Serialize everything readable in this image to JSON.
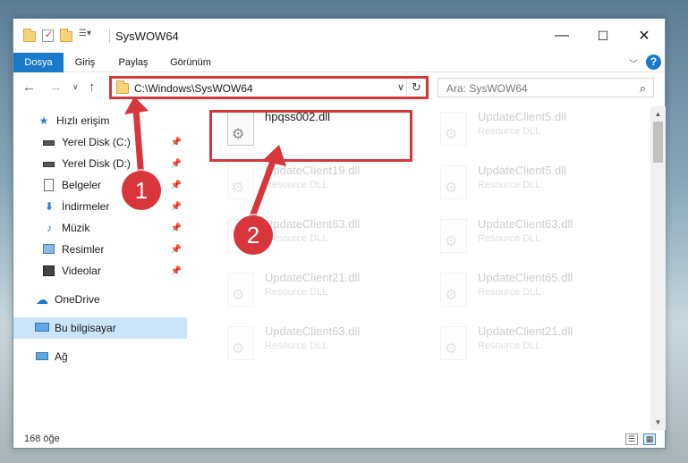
{
  "window": {
    "title": "SysWOW64",
    "controls": {
      "minimize": "—",
      "maximize": "☐",
      "close": "✕"
    }
  },
  "ribbon": {
    "tabs": [
      {
        "label": "Dosya",
        "active": true
      },
      {
        "label": "Giriş",
        "active": false
      },
      {
        "label": "Paylaş",
        "active": false
      },
      {
        "label": "Görünüm",
        "active": false
      }
    ],
    "help_label": "?"
  },
  "navigation": {
    "address": "C:\\Windows\\SysWOW64",
    "search_placeholder": "Ara: SysWOW64"
  },
  "sidebar": {
    "items": [
      {
        "label": "Hızlı erişim",
        "icon": "star-icon",
        "pinned": false,
        "selected": false
      },
      {
        "label": "Yerel Disk (C:)",
        "icon": "drive-icon",
        "pinned": true,
        "selected": false
      },
      {
        "label": "Yerel Disk (D:)",
        "icon": "drive-icon",
        "pinned": true,
        "selected": false
      },
      {
        "label": "Belgeler",
        "icon": "documents-icon",
        "pinned": true,
        "selected": false
      },
      {
        "label": "İndirmeler",
        "icon": "download-icon",
        "pinned": true,
        "selected": false
      },
      {
        "label": "Müzik",
        "icon": "music-icon",
        "pinned": true,
        "selected": false
      },
      {
        "label": "Resimler",
        "icon": "pictures-icon",
        "pinned": true,
        "selected": false
      },
      {
        "label": "Videolar",
        "icon": "videos-icon",
        "pinned": true,
        "selected": false
      },
      {
        "label": "OneDrive",
        "icon": "cloud-icon",
        "pinned": false,
        "selected": false
      },
      {
        "label": "Bu bilgisayar",
        "icon": "computer-icon",
        "pinned": false,
        "selected": true
      },
      {
        "label": "Ağ",
        "icon": "network-icon",
        "pinned": false,
        "selected": false
      }
    ]
  },
  "files": [
    {
      "name": "hpqss002.dll",
      "type": "",
      "highlighted": true
    },
    {
      "name": "UpdateClient5.dll",
      "type": "Resource DLL",
      "highlighted": false
    },
    {
      "name": "UpdateClient19.dll",
      "type": "Resource DLL",
      "highlighted": false
    },
    {
      "name": "UpdateClient5.dll",
      "type": "Resource DLL",
      "highlighted": false
    },
    {
      "name": "UpdateClient63.dll",
      "type": "Resource DLL",
      "highlighted": false
    },
    {
      "name": "UpdateClient63.dll",
      "type": "Resource DLL",
      "highlighted": false
    },
    {
      "name": "UpdateClient21.dll",
      "type": "Resource DLL",
      "highlighted": false
    },
    {
      "name": "UpdateClient65.dll",
      "type": "Resource DLL",
      "highlighted": false
    },
    {
      "name": "UpdateClient63.dll",
      "type": "Resource DLL",
      "highlighted": false
    },
    {
      "name": "UpdateClient21.dll",
      "type": "Resource DLL",
      "highlighted": false
    }
  ],
  "status": {
    "item_count": "168 öğe"
  },
  "annotations": [
    {
      "label": "1"
    },
    {
      "label": "2"
    }
  ],
  "colors": {
    "accent": "#1979ca",
    "annotation_red": "#d9363b",
    "selection": "#cce4f7"
  }
}
